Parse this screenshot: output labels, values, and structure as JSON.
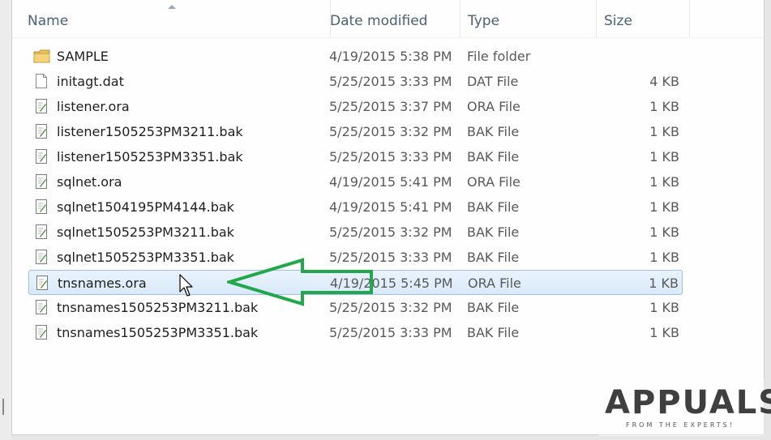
{
  "columns": {
    "name": "Name",
    "date": "Date modified",
    "type": "Type",
    "size": "Size"
  },
  "files": [
    {
      "name": "SAMPLE",
      "date": "4/19/2015 5:38 PM",
      "type": "File folder",
      "size": "",
      "icon": "folder-icon"
    },
    {
      "name": "initagt.dat",
      "date": "5/25/2015 3:33 PM",
      "type": "DAT File",
      "size": "4 KB",
      "icon": "document-icon"
    },
    {
      "name": "listener.ora",
      "date": "5/25/2015 3:37 PM",
      "type": "ORA File",
      "size": "1 KB",
      "icon": "edit-file-icon"
    },
    {
      "name": "listener1505253PM3211.bak",
      "date": "5/25/2015 3:32 PM",
      "type": "BAK File",
      "size": "1 KB",
      "icon": "edit-file-icon"
    },
    {
      "name": "listener1505253PM3351.bak",
      "date": "5/25/2015 3:33 PM",
      "type": "BAK File",
      "size": "1 KB",
      "icon": "edit-file-icon"
    },
    {
      "name": "sqlnet.ora",
      "date": "4/19/2015 5:41 PM",
      "type": "ORA File",
      "size": "1 KB",
      "icon": "edit-file-icon"
    },
    {
      "name": "sqlnet1504195PM4144.bak",
      "date": "4/19/2015 5:41 PM",
      "type": "BAK File",
      "size": "1 KB",
      "icon": "edit-file-icon"
    },
    {
      "name": "sqlnet1505253PM3211.bak",
      "date": "5/25/2015 3:32 PM",
      "type": "BAK File",
      "size": "1 KB",
      "icon": "edit-file-icon"
    },
    {
      "name": "sqlnet1505253PM3351.bak",
      "date": "5/25/2015 3:33 PM",
      "type": "BAK File",
      "size": "1 KB",
      "icon": "edit-file-icon"
    },
    {
      "name": "tnsnames.ora",
      "date": "4/19/2015 5:45 PM",
      "type": "ORA File",
      "size": "1 KB",
      "icon": "edit-file-icon",
      "selected": true
    },
    {
      "name": "tnsnames1505253PM3211.bak",
      "date": "5/25/2015 3:32 PM",
      "type": "BAK File",
      "size": "1 KB",
      "icon": "edit-file-icon"
    },
    {
      "name": "tnsnames1505253PM3351.bak",
      "date": "5/25/2015 3:33 PM",
      "type": "BAK File",
      "size": "1 KB",
      "icon": "edit-file-icon"
    }
  ],
  "colors": {
    "arrow": "#22a84a",
    "selection": "#d9e9fb",
    "header_text": "#4c607a"
  },
  "watermark": {
    "brand": "APPUALS",
    "tagline": "FROM THE EXPERTS!"
  }
}
